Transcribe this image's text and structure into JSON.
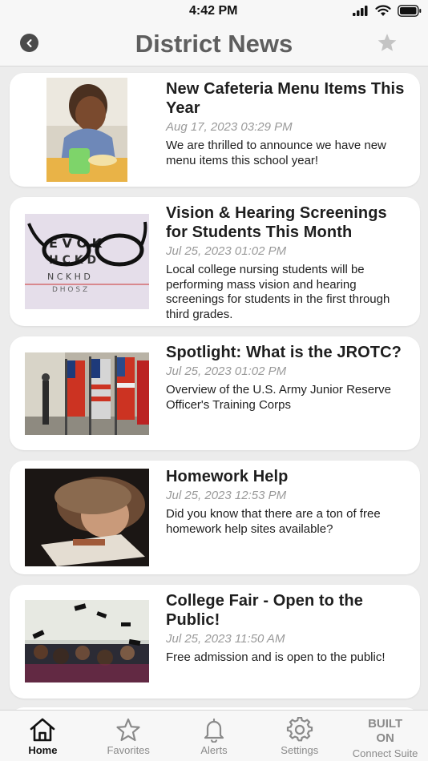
{
  "status": {
    "time": "4:42 PM"
  },
  "header": {
    "title": "District News"
  },
  "articles": [
    {
      "title": "New Cafeteria Menu Items This Year",
      "date": "Aug 17, 2023  03:29 PM",
      "description": "We are thrilled to announce we have new menu items this school year!"
    },
    {
      "title": "Vision & Hearing Screenings for Students This Month",
      "date": "Jul 25, 2023  01:02 PM",
      "description": "Local college nursing students will be performing mass vision and hearing screenings for students in the first through third grades."
    },
    {
      "title": "Spotlight: What is the JROTC?",
      "date": "Jul 25, 2023  01:02 PM",
      "description": "Overview of the U.S. Army Junior Reserve Officer's Training Corps"
    },
    {
      "title": "Homework Help",
      "date": "Jul 25, 2023  12:53 PM",
      "description": "Did you know that there are a ton of free homework help sites available?"
    },
    {
      "title": "College Fair - Open to the Public!",
      "date": "Jul 25, 2023  11:50 AM",
      "description": "Free admission and is open to the public!"
    }
  ],
  "tabs": [
    {
      "label": "Home",
      "icon": "home-icon",
      "active": true
    },
    {
      "label": "Favorites",
      "icon": "star-icon"
    },
    {
      "label": "Alerts",
      "icon": "bell-icon"
    },
    {
      "label": "Settings",
      "icon": "gear-icon"
    },
    {
      "label": "Connect Suite",
      "top_line_1": "BUILT",
      "top_line_2": "ON"
    }
  ],
  "colors": {
    "title_gray": "#5e5e5e",
    "date_gray": "#9a9a9a",
    "background": "#ececec",
    "card": "#ffffff"
  }
}
